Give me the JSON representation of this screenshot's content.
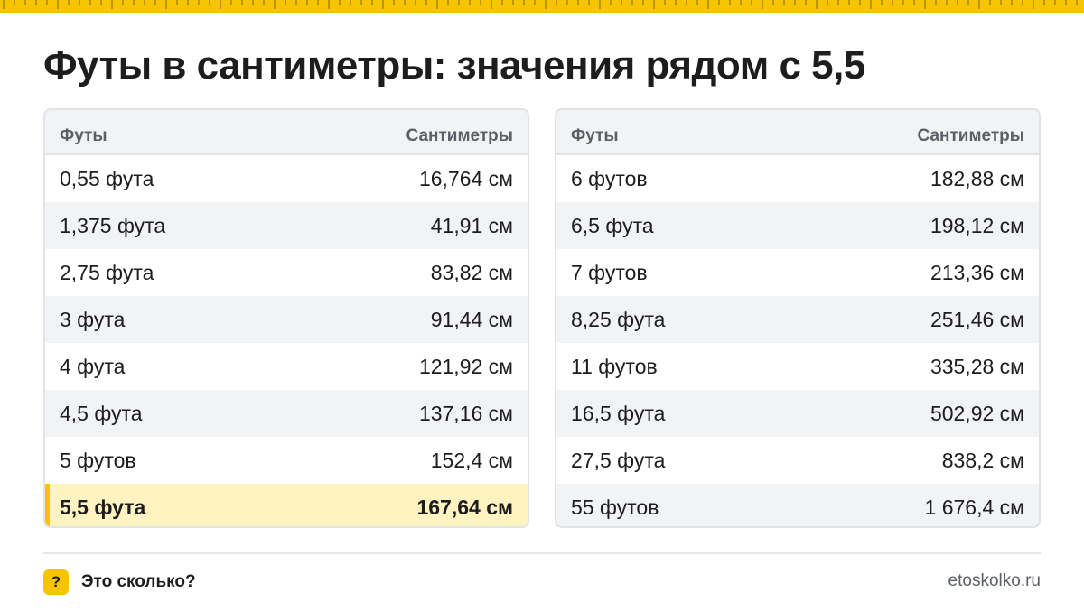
{
  "title": "Футы в сантиметры: значения рядом с 5,5",
  "colors": {
    "accent": "#f6c500",
    "highlight": "#fff3c2",
    "header_bg": "#f2f3f5"
  },
  "tables": [
    {
      "header": {
        "col1": "Футы",
        "col2": "Сантиметры"
      },
      "rows": [
        {
          "feet": "0,55 фута",
          "cm": "16,764 см"
        },
        {
          "feet": "1,375 фута",
          "cm": "41,91 см"
        },
        {
          "feet": "2,75 фута",
          "cm": "83,82 см"
        },
        {
          "feet": "3 фута",
          "cm": "91,44 см"
        },
        {
          "feet": "4 фута",
          "cm": "121,92 см"
        },
        {
          "feet": "4,5 фута",
          "cm": "137,16 см"
        },
        {
          "feet": "5 футов",
          "cm": "152,4 см"
        },
        {
          "feet": "5,5 фута",
          "cm": "167,64 см",
          "highlighted": true
        }
      ]
    },
    {
      "header": {
        "col1": "Футы",
        "col2": "Сантиметры"
      },
      "rows": [
        {
          "feet": "6 футов",
          "cm": "182,88 см"
        },
        {
          "feet": "6,5 фута",
          "cm": "198,12 см"
        },
        {
          "feet": "7 футов",
          "cm": "213,36 см"
        },
        {
          "feet": "8,25 фута",
          "cm": "251,46 см"
        },
        {
          "feet": "11 футов",
          "cm": "335,28 см"
        },
        {
          "feet": "16,5 фута",
          "cm": "502,92 см"
        },
        {
          "feet": "27,5 фута",
          "cm": "838,2 см"
        },
        {
          "feet": "55 футов",
          "cm": "1 676,4 см"
        }
      ]
    }
  ],
  "footer": {
    "icon": "question-mark-icon",
    "icon_glyph": "?",
    "brand": "Это сколько?",
    "site": "etoskolko.ru"
  }
}
